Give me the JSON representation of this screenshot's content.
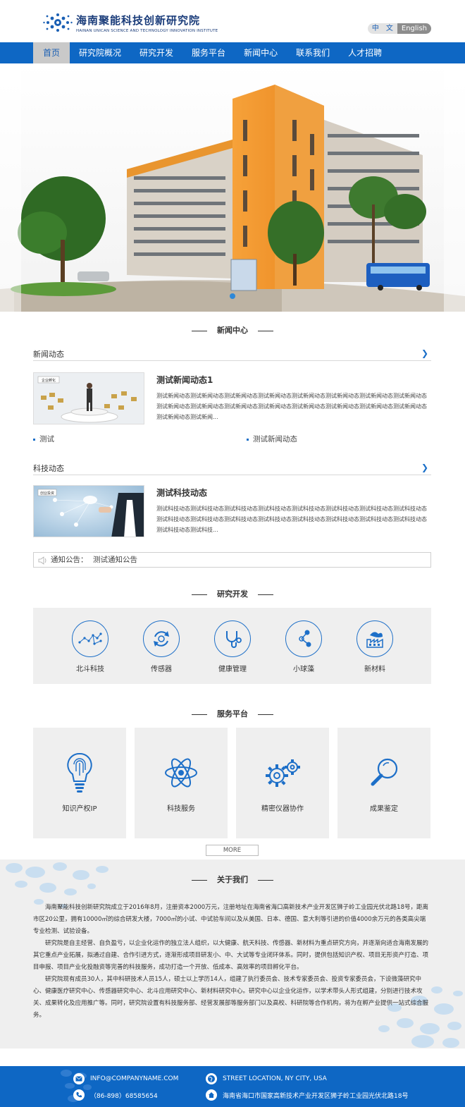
{
  "header": {
    "logo_cn": "海南聚能科技创新研究院",
    "logo_en": "HAINAN UNICAN SCIENCE AND TECHNOLOGY INNOVATION INSTITUTE",
    "lang_cn": "中　文",
    "lang_en": "English"
  },
  "nav": {
    "items": [
      {
        "label": "首页"
      },
      {
        "label": "研究院概况"
      },
      {
        "label": "研究开发"
      },
      {
        "label": "服务平台"
      },
      {
        "label": "新闻中心"
      },
      {
        "label": "联系我们"
      },
      {
        "label": "人才招聘"
      }
    ]
  },
  "news_section": {
    "title": "新闻中心",
    "news": {
      "heading": "新闻动态",
      "img_label": "企业孵化",
      "item_title": "测试新闻动态1",
      "item_desc": "测试新闻动态测试新闻动态测试新闻动态测试新闻动态测试新闻动态测试新闻动态测试新闻动态测试新闻动态测试新闻动态测试新闻动态测试新闻动态测试新闻动态测试新闻动态测试新闻动态测试新闻动态测试新闻动态测试新闻动态测试新闻...",
      "links": [
        "测试",
        "测试新闻动态"
      ]
    },
    "tech": {
      "heading": "科技动态",
      "img_label": "创业投资",
      "item_title": "测试科技动态",
      "item_desc": "测试科技动态测试科技动态测试科技动态测试科技动态测试科技动态测试科技动态测试科技动态测试科技动态测试科技动态测试科技动态测试科技动态测试科技动态测试科技动态测试科技动态测试科技动态测试科技动态测试科技动态测试科技..."
    },
    "notice": {
      "label": "通知公告：",
      "text": "测试通知公告"
    }
  },
  "rd_section": {
    "title": "研究开发",
    "items": [
      {
        "label": "北斗科技",
        "icon": "constellation-icon"
      },
      {
        "label": "传感器",
        "icon": "sensor-icon"
      },
      {
        "label": "健康管理",
        "icon": "stethoscope-icon"
      },
      {
        "label": "小球藻",
        "icon": "molecule-icon"
      },
      {
        "label": "新材料",
        "icon": "factory-icon"
      }
    ]
  },
  "service_section": {
    "title": "服务平台",
    "items": [
      {
        "label": "知识产权IP",
        "icon": "fingerprint-bulb-icon"
      },
      {
        "label": "科技服务",
        "icon": "atom-icon"
      },
      {
        "label": "精密仪器协作",
        "icon": "gears-icon"
      },
      {
        "label": "成果鉴定",
        "icon": "magnifier-icon"
      }
    ],
    "more": "MORE"
  },
  "about_section": {
    "title": "关于我们",
    "paragraphs": [
      "海南聚能科技创新研究院成立于2016年8月，注册资本2000万元，注册地址在海南省海口高新技术产业开发区狮子岭工业园光伏北路18号，距离市区20公里，拥有10000㎡的综合研发大楼，7000㎡的小试、中试验车间以及从美国、日本、德国、意大利等引进的价值4000余万元的各类高尖端专业检测、试验设备。",
      "研究院是自主经营、自负盈亏，以企业化运作的独立法人组织，以大健康、航天科技、传感器、新材料为重点研究方向，并逐渐向适合海南发展的其它重点产业拓展，拟通过自建、合作引进方式，逐渐形成项目研发小、中、大试等专业闭环体系。同时，提供包括知识产权、项目无形资产打造、项目申报、项目产业化投融资等完善的科技服务，成功打造一个开放、低成本、高效率的项目孵化平台。",
      "研究院现有成员30人，其中科研技术人员15人，硕士以上学历14人，组建了执行委员会、技术专家委员会、投资专家委员会，下设微藻研究中心、健康医疗研究中心、传感器研究中心、北斗应用研究中心、新材料研究中心。研究中心以企业化运作，以学术带头人形式组建，分别进行技术攻关、成果转化及应用推广等。同时，研究院设置有科技服务部、经营发展部等服务部门以及高校、科研院等合作机构，将为在孵产业提供一站式综合服务。"
    ]
  },
  "footer": {
    "email": "INFO@COMPANYNAME.COM",
    "location": "STREET LOCATION, NY CITY, USA",
    "phone": "（86-898）68585654",
    "address": "海南省海口市国家高新技术产业开发区狮子岭工业园光伏北路18号"
  },
  "colors": {
    "primary": "#0e67c4",
    "accent": "#1d6fc8",
    "panel": "#efefef"
  }
}
